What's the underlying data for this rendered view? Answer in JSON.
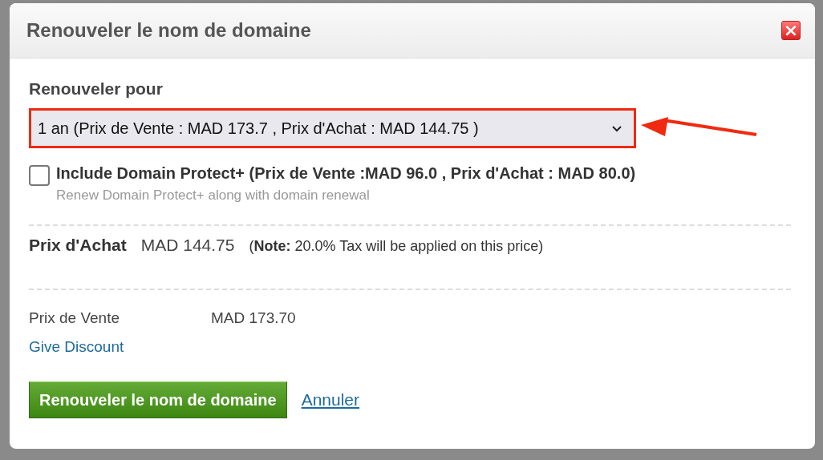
{
  "dialog": {
    "title": "Renouveler le nom de domaine",
    "close": "×"
  },
  "period": {
    "label": "Renouveler pour",
    "value": "1 an (Prix de Vente : MAD 173.7 , Prix d'Achat : MAD 144.75 )",
    "highlighted": true
  },
  "protect": {
    "label": "Include Domain Protect+ (Prix de Vente :MAD 96.0 , Prix d'Achat : MAD 80.0)",
    "hint": "Renew Domain Protect+ along with domain renewal",
    "checked": false
  },
  "purchase": {
    "label": "Prix d'Achat",
    "amount": "MAD 144.75",
    "note": "(**Note:** 20.0% Tax will be applied on this price)"
  },
  "sale": {
    "label": "Prix de Vente",
    "amount": "MAD 173.70",
    "link": "Give Discount"
  },
  "buttons": [
    {
      "kind": "primary",
      "label": "Renouveler le nom de domaine"
    },
    {
      "kind": "link",
      "label": "Annuler"
    }
  ]
}
